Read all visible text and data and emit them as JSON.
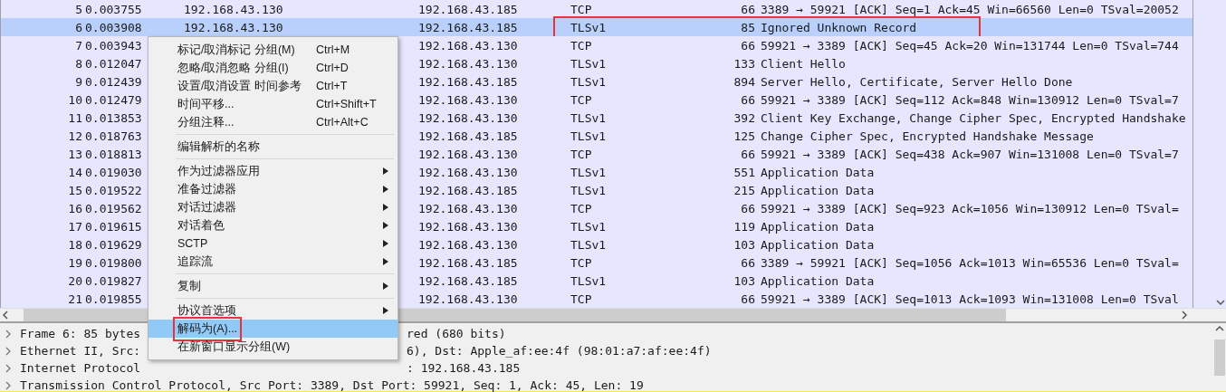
{
  "packet_list": {
    "rows": [
      {
        "no": "5",
        "time": "0.003755",
        "source": "192.168.43.130",
        "destination": "192.168.43.185",
        "protocol": "TCP",
        "length": "66",
        "info": "3389 → 59921 [ACK] Seq=1 Ack=45 Win=66560 Len=0 TSval=20052",
        "selected": false,
        "annotated": false
      },
      {
        "no": "6",
        "time": "0.003908",
        "source": "192.168.43.130",
        "destination": "192.168.43.185",
        "protocol": "TLSv1",
        "length": "85",
        "info": "Ignored Unknown Record",
        "selected": true,
        "annotated": true
      },
      {
        "no": "7",
        "time": "0.003943",
        "destination": "192.168.43.130",
        "protocol": "TCP",
        "length": "66",
        "info": "59921 → 3389 [ACK] Seq=45 Ack=20 Win=131744 Len=0 TSval=744",
        "selected": false,
        "annotated": false
      },
      {
        "no": "8",
        "time": "0.012047",
        "destination": "192.168.43.130",
        "protocol": "TLSv1",
        "length": "133",
        "info": "Client Hello",
        "selected": false,
        "annotated": false
      },
      {
        "no": "9",
        "time": "0.012439",
        "destination": "192.168.43.185",
        "protocol": "TLSv1",
        "length": "894",
        "info": "Server Hello, Certificate, Server Hello Done",
        "selected": false,
        "annotated": false
      },
      {
        "no": "10",
        "time": "0.012479",
        "destination": "192.168.43.130",
        "protocol": "TCP",
        "length": "66",
        "info": "59921 → 3389 [ACK] Seq=112 Ack=848 Win=130912 Len=0 TSval=7",
        "selected": false,
        "annotated": false
      },
      {
        "no": "11",
        "time": "0.013853",
        "destination": "192.168.43.130",
        "protocol": "TLSv1",
        "length": "392",
        "info": "Client Key Exchange, Change Cipher Spec, Encrypted Handshake",
        "selected": false,
        "annotated": false
      },
      {
        "no": "12",
        "time": "0.018763",
        "destination": "192.168.43.185",
        "protocol": "TLSv1",
        "length": "125",
        "info": "Change Cipher Spec, Encrypted Handshake Message",
        "selected": false,
        "annotated": false
      },
      {
        "no": "13",
        "time": "0.018813",
        "destination": "192.168.43.130",
        "protocol": "TCP",
        "length": "66",
        "info": "59921 → 3389 [ACK] Seq=438 Ack=907 Win=131008 Len=0 TSval=7",
        "selected": false,
        "annotated": false
      },
      {
        "no": "14",
        "time": "0.019030",
        "destination": "192.168.43.130",
        "protocol": "TLSv1",
        "length": "551",
        "info": "Application Data",
        "selected": false,
        "annotated": false
      },
      {
        "no": "15",
        "time": "0.019522",
        "destination": "192.168.43.185",
        "protocol": "TLSv1",
        "length": "215",
        "info": "Application Data",
        "selected": false,
        "annotated": false
      },
      {
        "no": "16",
        "time": "0.019562",
        "destination": "192.168.43.130",
        "protocol": "TCP",
        "length": "66",
        "info": "59921 → 3389 [ACK] Seq=923 Ack=1056 Win=130912 Len=0 TSval=",
        "selected": false,
        "annotated": false
      },
      {
        "no": "17",
        "time": "0.019615",
        "destination": "192.168.43.130",
        "protocol": "TLSv1",
        "length": "119",
        "info": "Application Data",
        "selected": false,
        "annotated": false
      },
      {
        "no": "18",
        "time": "0.019629",
        "destination": "192.168.43.130",
        "protocol": "TLSv1",
        "length": "103",
        "info": "Application Data",
        "selected": false,
        "annotated": false
      },
      {
        "no": "19",
        "time": "0.019800",
        "destination": "192.168.43.185",
        "protocol": "TCP",
        "length": "66",
        "info": "3389 → 59921 [ACK] Seq=1056 Ack=1013 Win=65536 Len=0 TSval=",
        "selected": false,
        "annotated": false
      },
      {
        "no": "20",
        "time": "0.019827",
        "destination": "192.168.43.185",
        "protocol": "TLSv1",
        "length": "103",
        "info": "Application Data",
        "selected": false,
        "annotated": false
      },
      {
        "no": "21",
        "time": "0.019855",
        "destination": "192.168.43.130",
        "protocol": "TCP",
        "length": "66",
        "info": "59921 → 3389 [ACK] Seq=1013 Ack=1093 Win=131008 Len=0 TSval",
        "selected": false,
        "annotated": false
      }
    ]
  },
  "packet_details": [
    {
      "left": "Frame 6: 85 bytes",
      "right": "red (680 bits)"
    },
    {
      "left": "Ethernet II, Src:",
      "right": "6), Dst: Apple_af:ee:4f (98:01:a7:af:ee:4f)"
    },
    {
      "left": "Internet Protocol",
      "right": ": 192.168.43.185"
    },
    {
      "left": "Transmission Control Protocol, Src Port: 3389, Dst Port: 59921, Seq: 1, Ack: 45, Len: 19"
    }
  ],
  "context_menu": {
    "groups": [
      [
        {
          "label": "标记/取消标记 分组(M)",
          "shortcut": "Ctrl+M",
          "submenu": false,
          "selected": false,
          "annotated": false
        },
        {
          "label": "忽略/取消忽略 分组(I)",
          "shortcut": "Ctrl+D",
          "submenu": false,
          "selected": false,
          "annotated": false
        },
        {
          "label": "设置/取消设置 时间参考",
          "shortcut": "Ctrl+T",
          "submenu": false,
          "selected": false,
          "annotated": false
        },
        {
          "label": "时间平移...",
          "shortcut": "Ctrl+Shift+T",
          "submenu": false,
          "selected": false,
          "annotated": false
        },
        {
          "label": "分组注释...",
          "shortcut": "Ctrl+Alt+C",
          "submenu": false,
          "selected": false,
          "annotated": false
        }
      ],
      [
        {
          "label": "编辑解析的名称",
          "submenu": false,
          "selected": false,
          "annotated": false
        }
      ],
      [
        {
          "label": "作为过滤器应用",
          "submenu": true,
          "selected": false,
          "annotated": false
        },
        {
          "label": "准备过滤器",
          "submenu": true,
          "selected": false,
          "annotated": false
        },
        {
          "label": "对话过滤器",
          "submenu": true,
          "selected": false,
          "annotated": false
        },
        {
          "label": "对话着色",
          "submenu": true,
          "selected": false,
          "annotated": false
        },
        {
          "label": "SCTP",
          "submenu": true,
          "selected": false,
          "annotated": false
        },
        {
          "label": "追踪流",
          "submenu": true,
          "selected": false,
          "annotated": false
        }
      ],
      [
        {
          "label": "复制",
          "submenu": true,
          "selected": false,
          "annotated": false
        }
      ],
      [
        {
          "label": "协议首选项",
          "submenu": true,
          "selected": false,
          "annotated": false
        },
        {
          "label": "解码为(A)...",
          "submenu": false,
          "selected": true,
          "annotated": true
        },
        {
          "label": "在新窗口显示分组(W)",
          "submenu": false,
          "selected": false,
          "annotated": false
        }
      ]
    ]
  }
}
